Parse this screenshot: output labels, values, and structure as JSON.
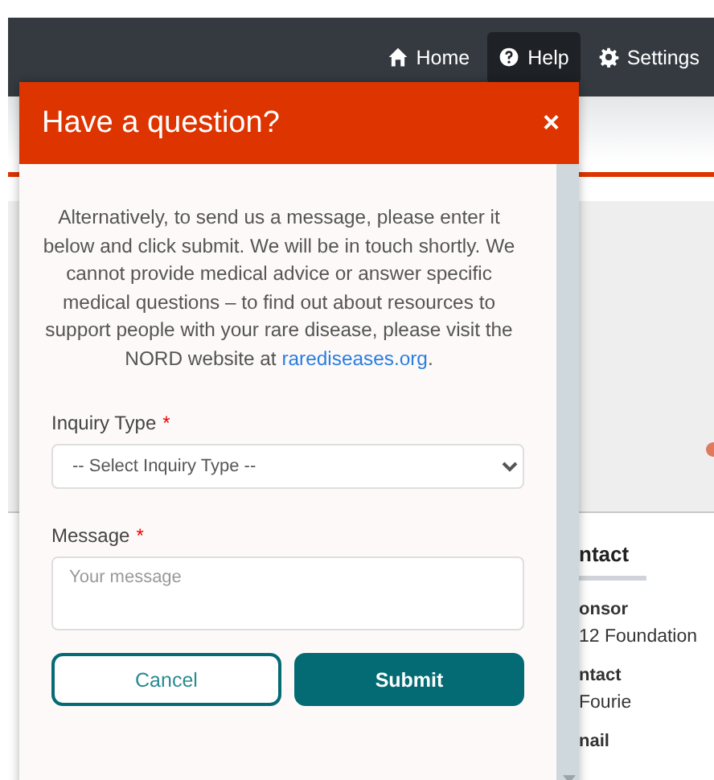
{
  "navbar": {
    "items": [
      {
        "label": "Home",
        "kind": "home",
        "selected": false
      },
      {
        "label": "Help",
        "kind": "help",
        "selected": true
      },
      {
        "label": "Settings",
        "kind": "gear",
        "selected": false
      }
    ]
  },
  "background": {
    "contact": {
      "heading": "ntact",
      "items": [
        {
          "label": "onsor",
          "value": "12 Foundation"
        },
        {
          "label": "ntact",
          "value": "Fourie"
        },
        {
          "label": "nail"
        }
      ]
    }
  },
  "dialog": {
    "title": "Have a question?",
    "close": "×",
    "intro": "Alternatively, to send us a message, please enter it below and click submit. We will be in touch shortly. We cannot provide medical advice or answer specific medical questions – to find out about resources to support people with your rare disease, please visit the NORD website at",
    "link": "rarediseases.org",
    "intro_end": ".",
    "fields": [
      {
        "kind": "select",
        "label": "Inquiry Type",
        "required_mark": "*",
        "placeholder": "-- Select Inquiry Type --"
      },
      {
        "kind": "textarea",
        "label": "Message",
        "required_mark": "*",
        "placeholder": "Your message"
      }
    ],
    "buttons": [
      {
        "kind": "secondary",
        "label": "Cancel"
      },
      {
        "kind": "primary",
        "label": "Submit"
      }
    ]
  }
}
